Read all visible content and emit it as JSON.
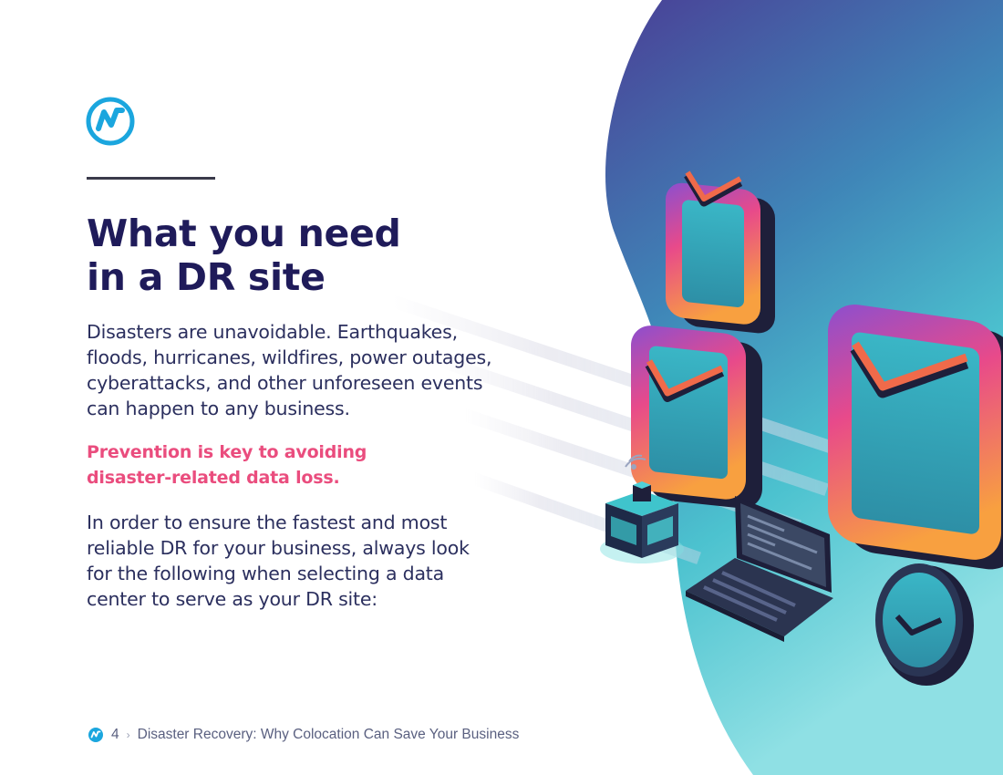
{
  "brand": {
    "logo_icon": "brand-logo-icon",
    "accent_color": "#1ba6de",
    "primary_color": "#1f1b5a",
    "highlight_color": "#ea4d7e"
  },
  "heading": {
    "lines": [
      "What you need",
      "in a DR site"
    ]
  },
  "intro": {
    "lines": [
      "Disasters are unavoidable. Earthquakes,",
      "floods, hurricanes, wildfires, power outages,",
      "cyberattacks, and other unforeseen events",
      "can happen to any business."
    ]
  },
  "emphasis": {
    "lines": [
      "Prevention is key to avoiding",
      "disaster-related data loss."
    ]
  },
  "closing": {
    "lines": [
      "In order to ensure the fastest and most",
      "reliable DR for your business, always look",
      "for the following when selecting a data",
      "center to serve as your DR site:"
    ]
  },
  "footer": {
    "page_number": "4",
    "separator": "›",
    "title": "Disaster Recovery: Why Colocation Can Save Your Business"
  },
  "illustration": {
    "icons": [
      "checkbox-icon",
      "checkbox-icon",
      "checkbox-icon",
      "server-icon",
      "wifi-icon",
      "laptop-icon",
      "clock-icon"
    ]
  }
}
